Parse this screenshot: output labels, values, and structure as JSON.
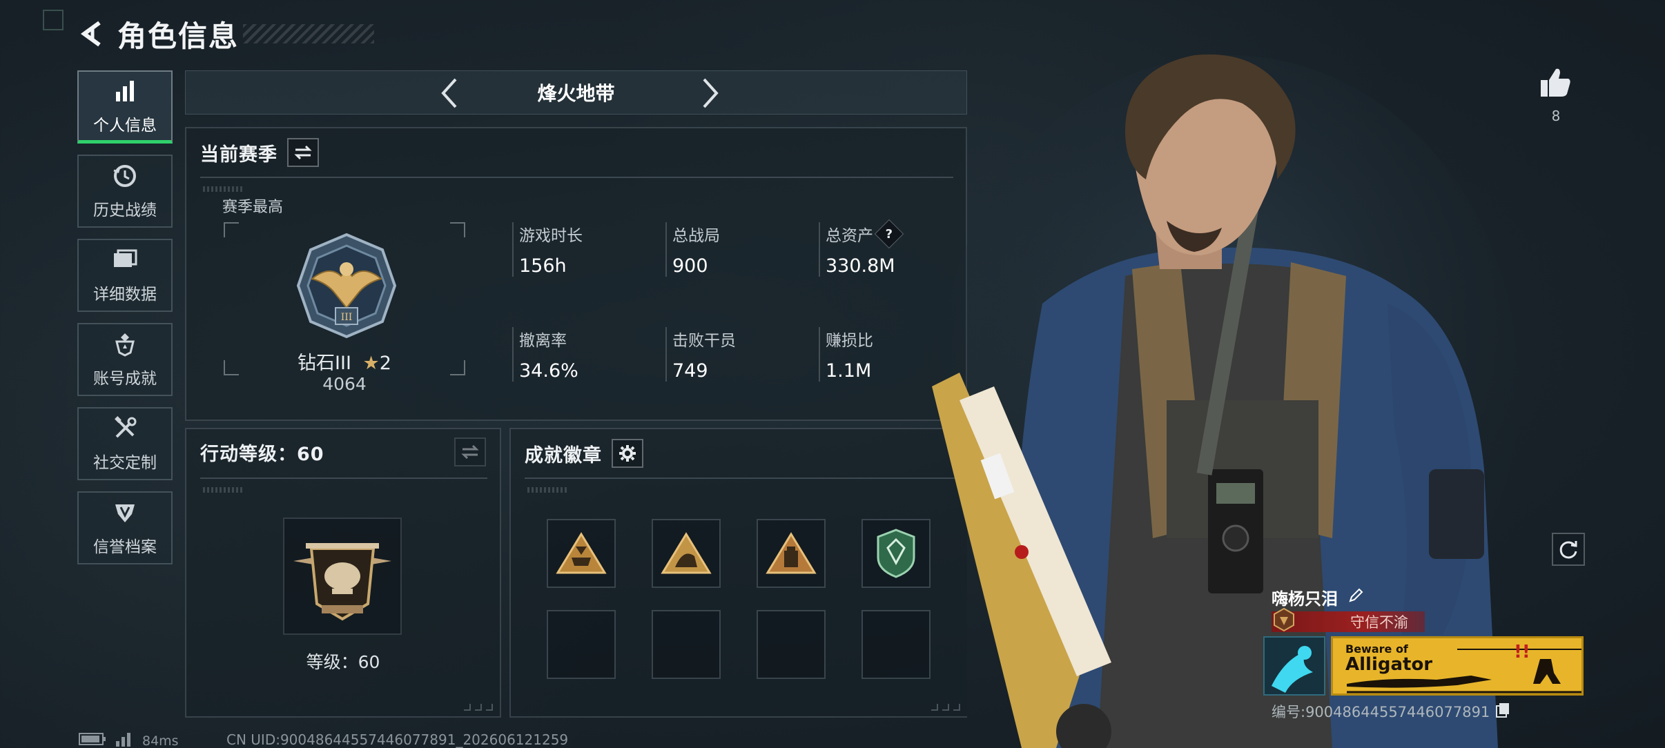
{
  "header": {
    "title": "角色信息",
    "back_icon": "back-arrow-icon"
  },
  "sidebar": {
    "items": [
      {
        "label": "个人信息",
        "icon": "bar-chart-icon",
        "active": true
      },
      {
        "label": "历史战绩",
        "icon": "history-clock-icon"
      },
      {
        "label": "详细数据",
        "icon": "folder-icon"
      },
      {
        "label": "账号成就",
        "icon": "achievement-icon"
      },
      {
        "label": "社交定制",
        "icon": "tools-icon"
      },
      {
        "label": "信誉档案",
        "icon": "reputation-shield-icon"
      }
    ]
  },
  "mode": {
    "title": "烽火地带"
  },
  "season": {
    "title": "当前赛季",
    "rank_caption": "赛季最高",
    "rank_name": "钻石III",
    "rank_stars": "2",
    "rank_score": "4064",
    "stats": [
      {
        "label": "游戏时长",
        "value": "156h"
      },
      {
        "label": "总战局",
        "value": "900"
      },
      {
        "label": "总资产",
        "value": "330.8M",
        "help": "?"
      },
      {
        "label": "撤离率",
        "value": "34.6%"
      },
      {
        "label": "击败干员",
        "value": "749"
      },
      {
        "label": "赚损比",
        "value": "1.1M"
      }
    ]
  },
  "action_level": {
    "title": "行动等级：60",
    "level_label": "等级：60"
  },
  "badges": {
    "title": "成就徽章",
    "filled": 4,
    "empty": 4
  },
  "profile": {
    "like_count": "8",
    "player_name": "嗨杨只泪",
    "player_title": "守信不渝",
    "banner_small": "Beware of",
    "banner_big": "Alligator",
    "uid_line": "编号:9004864455744607789​1"
  },
  "status": {
    "ping": "84ms",
    "uid": "CN UID:9004864455744607789​1_202606121259"
  },
  "colors": {
    "accent_green": "#2fd06a",
    "title_red": "#9b2020",
    "banner_yellow": "#e8b52a"
  }
}
